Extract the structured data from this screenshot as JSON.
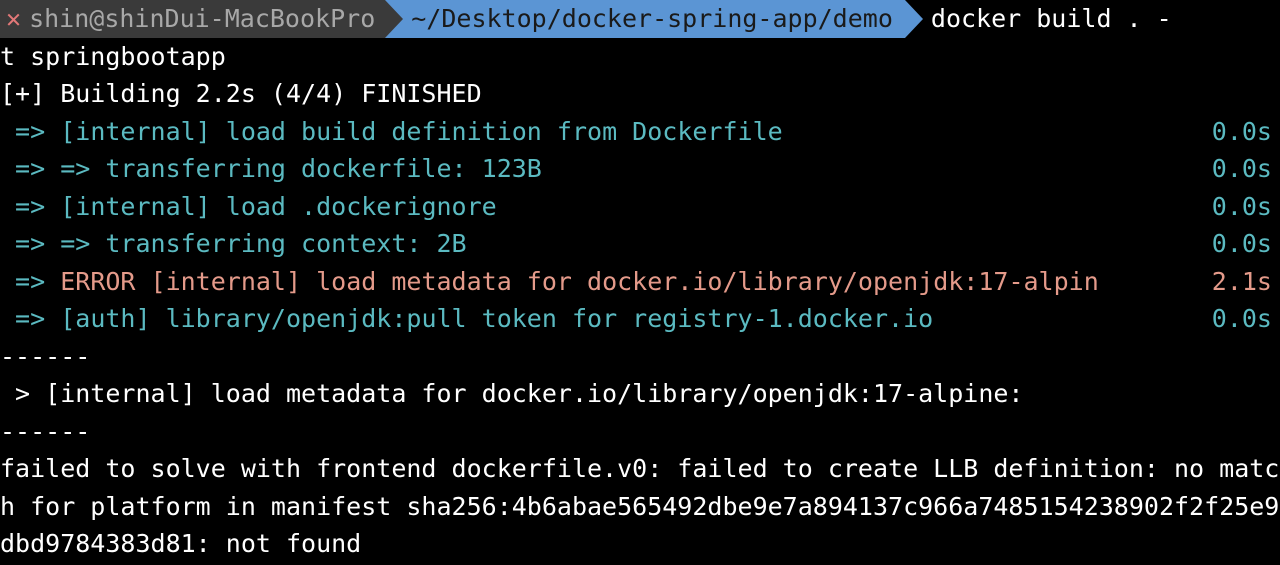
{
  "prompt": {
    "user": "shin@shinDui-MacBookPro",
    "path": "~/Desktop/docker-spring-app/demo",
    "command_part1": "docker build . -",
    "command_part2": "t springbootapp"
  },
  "build_header": "[+] Building 2.2s (4/4) FINISHED",
  "steps": [
    {
      "arrows": " => ",
      "text": "[internal] load build definition from Dockerfile",
      "time": "0.0s",
      "error": false
    },
    {
      "arrows": " => => ",
      "text": "transferring dockerfile: 123B",
      "time": "0.0s",
      "error": false
    },
    {
      "arrows": " => ",
      "text": "[internal] load .dockerignore",
      "time": "0.0s",
      "error": false
    },
    {
      "arrows": " => => ",
      "text": "transferring context: 2B",
      "time": "0.0s",
      "error": false
    },
    {
      "arrows": " => ",
      "text": "ERROR [internal] load metadata for docker.io/library/openjdk:17-alpin",
      "time": "2.1s",
      "error": true
    },
    {
      "arrows": " => ",
      "text": "[auth] library/openjdk:pull token for registry-1.docker.io",
      "time": "0.0s",
      "error": false
    }
  ],
  "divider": "------",
  "error_detail": " > [internal] load metadata for docker.io/library/openjdk:17-alpine:",
  "error_message": "failed to solve with frontend dockerfile.v0: failed to create LLB definition: no match for platform in manifest sha256:4b6abae565492dbe9e7a894137c966a7485154238902f2f25e9dbd9784383d81: not found"
}
